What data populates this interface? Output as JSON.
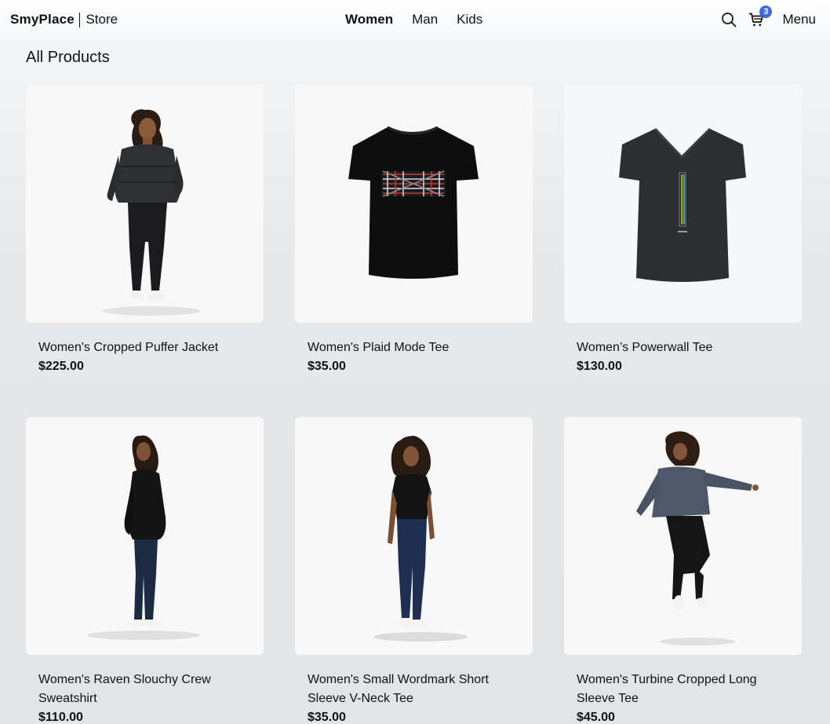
{
  "header": {
    "brand": "SmyPlace",
    "store": "Store",
    "nav": [
      {
        "label": "Women",
        "active": true
      },
      {
        "label": "Man",
        "active": false
      },
      {
        "label": "Kids",
        "active": false
      }
    ],
    "search_icon": "search-icon",
    "cart_icon": "cart-icon",
    "cart_count": "3",
    "menu_label": "Menu"
  },
  "page": {
    "title": "All Products"
  },
  "products": [
    {
      "name": "Women's Cropped Puffer Jacket",
      "price": "$225.00",
      "image": "woman-in-black-puffer-jacket"
    },
    {
      "name": "Women's Plaid Mode Tee",
      "price": "$35.00",
      "image": "black-tee-plaid-graphic"
    },
    {
      "name": "Women’s Powerwall Tee",
      "price": "$130.00",
      "image": "charcoal-tee-vertical-stripe"
    },
    {
      "name": "Women's Raven Slouchy Crew Sweatshirt",
      "price": "$110.00",
      "image": "woman-black-sweatshirt-side"
    },
    {
      "name": "Women's Small Wordmark Short Sleeve V-Neck Tee",
      "price": "$35.00",
      "image": "woman-black-vneck-jeans"
    },
    {
      "name": "Women's Turbine Cropped Long Sleeve Tee",
      "price": "$45.00",
      "image": "woman-gray-longsleeve-jumping"
    }
  ],
  "colors": {
    "accent": "#3e6ae1",
    "text": "#111111",
    "image_bg": "#f8f8f8"
  }
}
